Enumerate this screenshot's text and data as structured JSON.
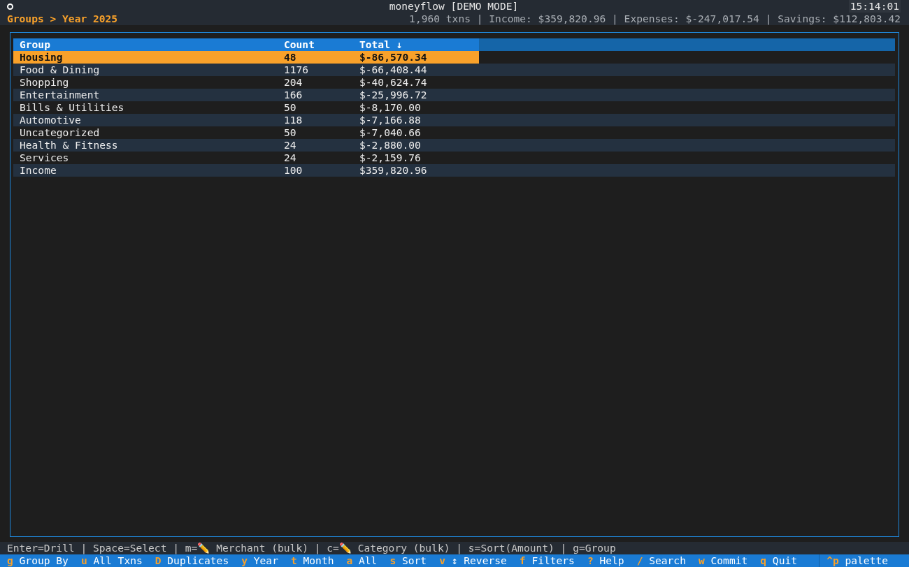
{
  "header": {
    "title": "moneyflow [DEMO MODE]",
    "clock": "15:14:01",
    "breadcrumb": "Groups > Year 2025",
    "summary": "1,960 txns | Income: $359,820.96 | Expenses: $-247,017.54 | Savings: $112,803.42"
  },
  "table": {
    "columns": [
      "Group",
      "Count",
      "Total ↓"
    ],
    "rows": [
      {
        "cells": [
          "Housing",
          "48",
          "$-86,570.34"
        ],
        "selected": true
      },
      {
        "cells": [
          "Food & Dining",
          "1176",
          "$-66,408.44"
        ],
        "selected": false
      },
      {
        "cells": [
          "Shopping",
          "204",
          "$-40,624.74"
        ],
        "selected": false
      },
      {
        "cells": [
          "Entertainment",
          "166",
          "$-25,996.72"
        ],
        "selected": false
      },
      {
        "cells": [
          "Bills & Utilities",
          "50",
          "$-8,170.00"
        ],
        "selected": false
      },
      {
        "cells": [
          "Automotive",
          "118",
          "$-7,166.88"
        ],
        "selected": false
      },
      {
        "cells": [
          "Uncategorized",
          "50",
          "$-7,040.66"
        ],
        "selected": false
      },
      {
        "cells": [
          "Health & Fitness",
          "24",
          "$-2,880.00"
        ],
        "selected": false
      },
      {
        "cells": [
          "Services",
          "24",
          "$-2,159.76"
        ],
        "selected": false
      },
      {
        "cells": [
          "Income",
          "100",
          "$359,820.96"
        ],
        "selected": false
      }
    ]
  },
  "hint": "Enter=Drill | Space=Select | m=✏️ Merchant (bulk) | c=✏️ Category (bulk) | s=Sort(Amount) | g=Group",
  "keys": [
    {
      "key": "g",
      "label": "Group By"
    },
    {
      "key": "u",
      "label": "All Txns"
    },
    {
      "key": "D",
      "label": "Duplicates"
    },
    {
      "key": "y",
      "label": "Year"
    },
    {
      "key": "t",
      "label": "Month"
    },
    {
      "key": "a",
      "label": "All"
    },
    {
      "key": "s",
      "label": "Sort"
    },
    {
      "key": "v",
      "label": "↕ Reverse"
    },
    {
      "key": "f",
      "label": "Filters"
    },
    {
      "key": "?",
      "label": "Help"
    },
    {
      "key": "/",
      "label": "Search"
    },
    {
      "key": "w",
      "label": "Commit"
    },
    {
      "key": "q",
      "label": "Quit"
    }
  ],
  "palette": {
    "key": "^p",
    "label": "palette"
  }
}
